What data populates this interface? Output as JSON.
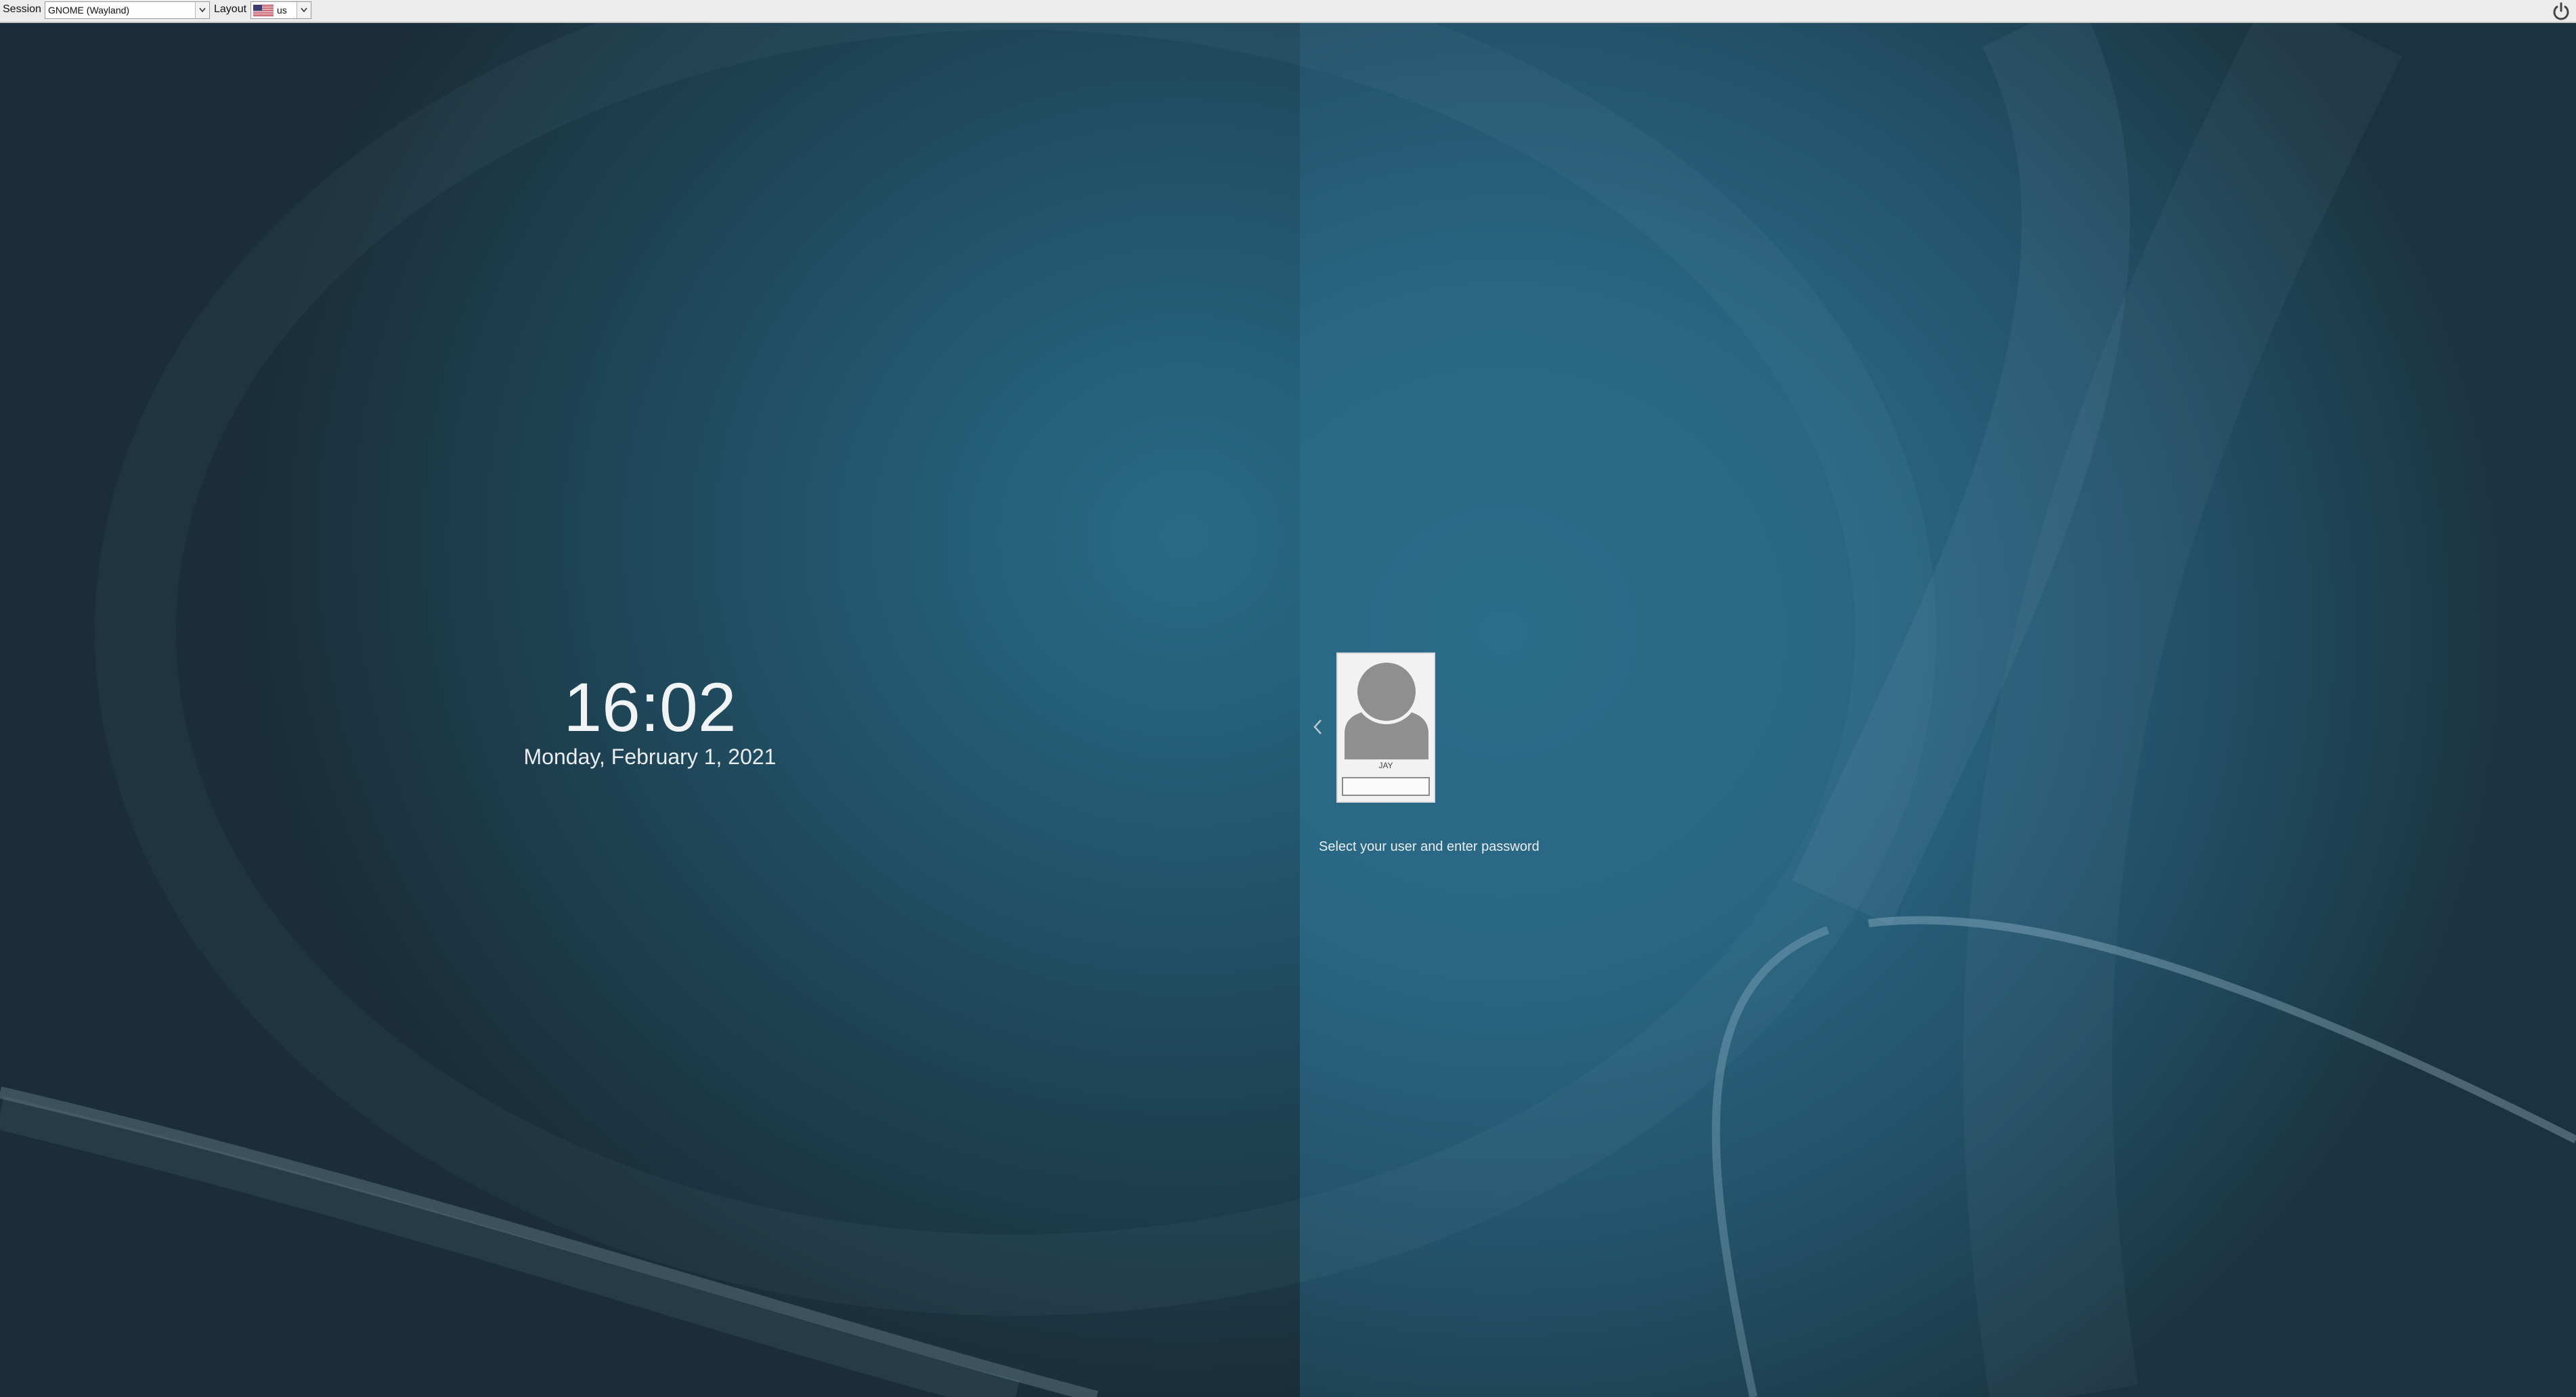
{
  "topbar": {
    "session_label": "Session",
    "session_value": "GNOME (Wayland)",
    "layout_label": "Layout",
    "layout_value": "us",
    "layout_flag_icon": "us-flag-icon",
    "power_icon": "power-icon"
  },
  "clock": {
    "time": "16:02",
    "date": "Monday, February 1, 2021"
  },
  "login": {
    "user_name": "JAY",
    "password_value": "",
    "hint": "Select your user and enter password"
  },
  "colors": {
    "background_dark": "#1a2d38",
    "background_accent": "#2a6a86",
    "text_light": "#f1f4f6"
  }
}
